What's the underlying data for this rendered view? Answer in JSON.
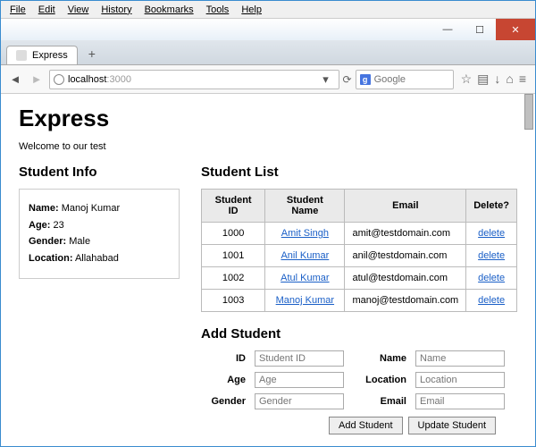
{
  "menu": {
    "file": "File",
    "edit": "Edit",
    "view": "View",
    "history": "History",
    "bookmarks": "Bookmarks",
    "tools": "Tools",
    "help": "Help"
  },
  "tab": {
    "title": "Express"
  },
  "url": {
    "host": "localhost",
    "port": ":3000"
  },
  "search": {
    "placeholder": "Google",
    "engine": "g"
  },
  "page": {
    "title": "Express",
    "welcome": "Welcome to our test",
    "info_heading": "Student Info",
    "list_heading": "Student List",
    "add_heading": "Add Student"
  },
  "info": {
    "name_label": "Name:",
    "name": "Manoj Kumar",
    "age_label": "Age:",
    "age": "23",
    "gender_label": "Gender:",
    "gender": "Male",
    "location_label": "Location:",
    "location": "Allahabad"
  },
  "headers": {
    "id": "Student ID",
    "name": "Student Name",
    "email": "Email",
    "delete": "Delete?"
  },
  "students": [
    {
      "id": "1000",
      "name": "Amit Singh",
      "email": "amit@testdomain.com",
      "del": "delete"
    },
    {
      "id": "1001",
      "name": "Anil Kumar",
      "email": "anil@testdomain.com",
      "del": "delete"
    },
    {
      "id": "1002",
      "name": "Atul Kumar",
      "email": "atul@testdomain.com",
      "del": "delete"
    },
    {
      "id": "1003",
      "name": "Manoj Kumar",
      "email": "manoj@testdomain.com",
      "del": "delete"
    }
  ],
  "form": {
    "id_label": "ID",
    "id_ph": "Student ID",
    "name_label": "Name",
    "name_ph": "Name",
    "age_label": "Age",
    "age_ph": "Age",
    "location_label": "Location",
    "location_ph": "Location",
    "gender_label": "Gender",
    "gender_ph": "Gender",
    "email_label": "Email",
    "email_ph": "Email",
    "add_btn": "Add Student",
    "update_btn": "Update Student"
  }
}
